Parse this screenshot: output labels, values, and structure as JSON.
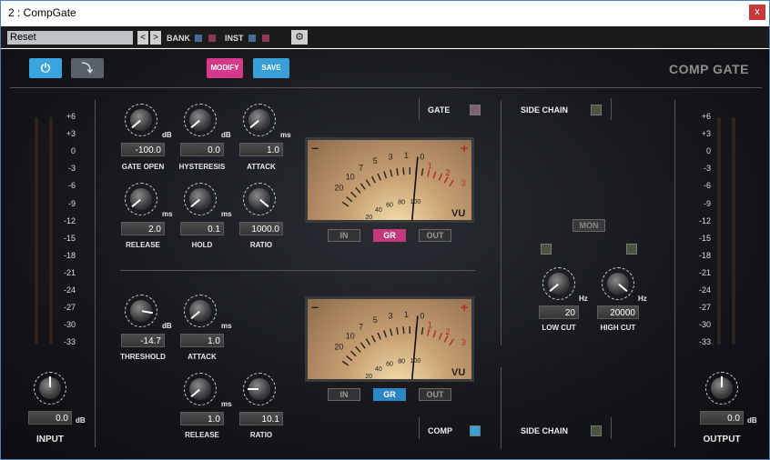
{
  "window": {
    "title": "2 : CompGate",
    "close": "x"
  },
  "host": {
    "preset": "Reset",
    "prev": "<",
    "next": ">",
    "bank": "BANK",
    "inst": "INST",
    "gear": "⚙"
  },
  "top": {
    "modify": "MODIFY",
    "save": "SAVE",
    "brand": "COMP GATE"
  },
  "scale": [
    "+6",
    "+3",
    "0",
    "-3",
    "-6",
    "-9",
    "-12",
    "-15",
    "-18",
    "-21",
    "-24",
    "-27",
    "-30",
    "-33"
  ],
  "gate": {
    "title": "GATE",
    "open": {
      "value": "-100.0",
      "unit": "dB",
      "label": "GATE OPEN"
    },
    "hyst": {
      "value": "0.0",
      "unit": "dB",
      "label": "HYSTERESIS"
    },
    "attack": {
      "value": "1.0",
      "unit": "ms",
      "label": "ATTACK"
    },
    "release": {
      "value": "2.0",
      "unit": "ms",
      "label": "RELEASE"
    },
    "hold": {
      "value": "0.1",
      "unit": "ms",
      "label": "HOLD"
    },
    "ratio": {
      "value": "1000.0",
      "label": "RATIO"
    }
  },
  "comp": {
    "title": "COMP",
    "threshold": {
      "value": "-14.7",
      "unit": "dB",
      "label": "THRESHOLD"
    },
    "attack": {
      "value": "1.0",
      "unit": "ms",
      "label": "ATTACK"
    },
    "release": {
      "value": "1.0",
      "unit": "ms",
      "label": "RELEASE"
    },
    "ratio": {
      "value": "10.1",
      "label": "RATIO"
    }
  },
  "vu": {
    "label": "VU",
    "in": "IN",
    "gr": "GR",
    "out": "OUT",
    "ticks_top": [
      "20",
      "10",
      "7",
      "5",
      "3",
      "1",
      "0"
    ],
    "ticks_red": [
      "1",
      "2",
      "3"
    ],
    "ticks_bottom": [
      "0",
      "20",
      "40",
      "60",
      "80",
      "100"
    ]
  },
  "sidechain": {
    "title": "SIDE CHAIN",
    "mon": "MON",
    "lowcut": {
      "value": "20",
      "unit": "Hz",
      "label": "LOW CUT"
    },
    "highcut": {
      "value": "20000",
      "unit": "Hz",
      "label": "HIGH CUT"
    }
  },
  "input": {
    "value": "0.0",
    "unit": "dB",
    "label": "INPUT"
  },
  "output": {
    "value": "0.0",
    "unit": "dB",
    "label": "OUTPUT"
  },
  "colors": {
    "modify": "#d6388a",
    "save": "#3a9fd6",
    "gr_gate": "#c2397c",
    "gr_comp": "#2b86c5"
  }
}
